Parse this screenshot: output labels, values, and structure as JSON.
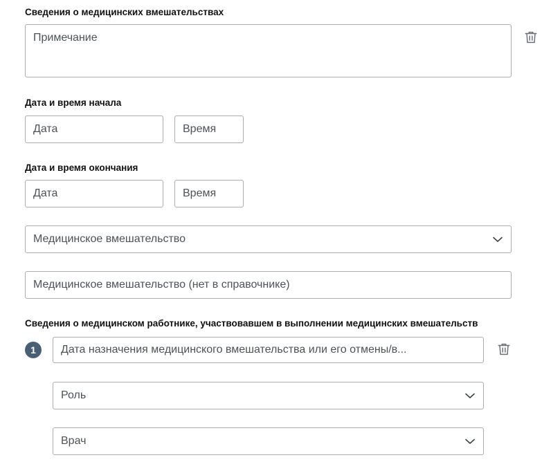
{
  "interventions": {
    "title": "Сведения о медицинских вмешательствах",
    "note_placeholder": "Примечание",
    "start": {
      "label": "Дата и время начала",
      "date_placeholder": "Дата",
      "time_placeholder": "Время"
    },
    "end": {
      "label": "Дата и время окончания",
      "date_placeholder": "Дата",
      "time_placeholder": "Время"
    },
    "intervention_select": "Медицинское вмешательство",
    "intervention_custom_placeholder": "Медицинское вмешательство (нет в справочнике)"
  },
  "workers": {
    "title": "Сведения о медицинском работнике, участвовавшем в выполнении медицинских вмешательств",
    "items": [
      {
        "number": "1",
        "assignment_date_placeholder": "Дата назначения медицинского вмешательства или его отмены/в...",
        "role_select": "Роль",
        "position_select": "Врач"
      }
    ]
  },
  "icons": {
    "delete": "trash-icon",
    "dropdown": "chevron-down-icon"
  },
  "colors": {
    "border": "#a9adb3",
    "badge": "#4a5f74",
    "text": "#4d5257"
  }
}
